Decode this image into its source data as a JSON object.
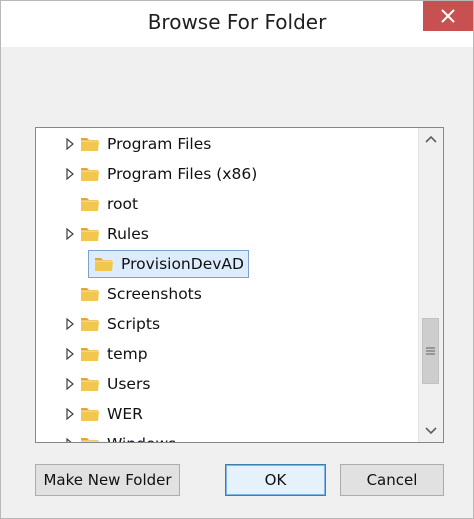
{
  "window": {
    "title": "Browse For Folder"
  },
  "tree": {
    "items": [
      {
        "label": "Program Files",
        "expandable": true
      },
      {
        "label": "Program Files (x86)",
        "expandable": true
      },
      {
        "label": "root",
        "expandable": false
      },
      {
        "label": "Rules",
        "expandable": true
      },
      {
        "label": "ProvisionDevAD",
        "expandable": false,
        "selected": true
      },
      {
        "label": "Screenshots",
        "expandable": false
      },
      {
        "label": "Scripts",
        "expandable": true
      },
      {
        "label": "temp",
        "expandable": true
      },
      {
        "label": "Users",
        "expandable": true
      },
      {
        "label": "WER",
        "expandable": true
      },
      {
        "label": "Windows",
        "expandable": true
      }
    ]
  },
  "buttons": {
    "make_new_folder": "Make New Folder",
    "ok": "OK",
    "cancel": "Cancel"
  },
  "icons": {
    "close": "close-icon",
    "folder": "folder-icon",
    "expander": "triangle-right-icon",
    "scroll_up": "chevron-up-icon",
    "scroll_down": "chevron-down-icon"
  },
  "colors": {
    "close_button": "#c75050",
    "selection_fill": "#ddecfc",
    "selection_border": "#7da2ce",
    "default_button_border": "#3c7fb1",
    "folder_yellow": "#f1c84d"
  }
}
